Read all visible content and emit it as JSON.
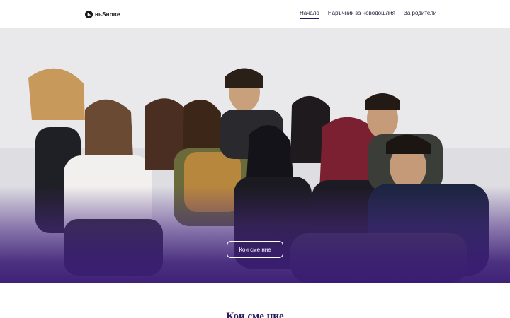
{
  "header": {
    "logo_text": "ньЅнове",
    "logo_mark": "ь",
    "nav": [
      {
        "label": "Начало",
        "active": true
      },
      {
        "label": "Наръчник за новодошлия",
        "active": false
      },
      {
        "label": "За родители",
        "active": false
      }
    ]
  },
  "hero": {
    "cta_label": "Кои сме ние"
  },
  "section": {
    "title": "Кои сме ние"
  },
  "colors": {
    "accent": "#3d1f78",
    "nav_text": "#1f1f3a"
  }
}
